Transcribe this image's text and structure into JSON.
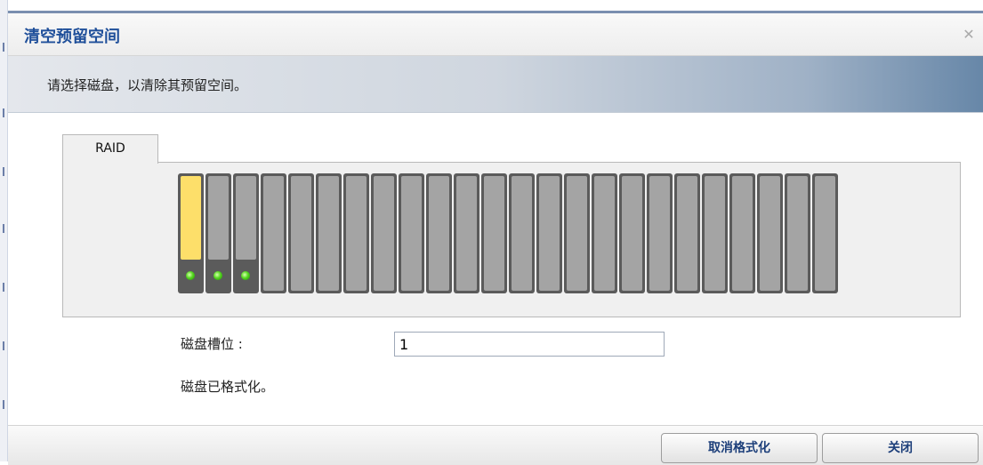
{
  "dialog": {
    "title": "清空预留空间",
    "close_icon": "close-icon",
    "instruction": "请选择磁盘，以清除其预留空间。"
  },
  "tab": {
    "label": "RAID"
  },
  "disk_map": {
    "slot_count": 24,
    "selected_slot": 1,
    "used_slots": [
      1,
      2,
      3
    ],
    "colors": {
      "selected": "#fddf6a",
      "empty": "#a4a4a4",
      "frame": "#5b5b5b",
      "led": "#55d61f"
    }
  },
  "form": {
    "slot_label": "磁盘槽位 :",
    "slot_value": "1",
    "status": "磁盘已格式化。"
  },
  "buttons": {
    "cancel_format": "取消格式化",
    "close": "关闭"
  }
}
